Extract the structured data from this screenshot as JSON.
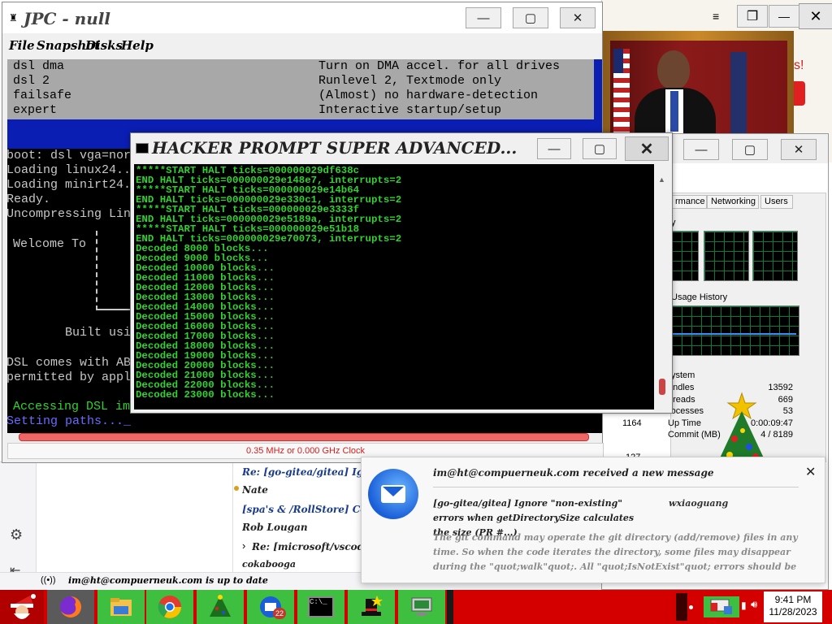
{
  "jpc": {
    "title": "JPC - null",
    "menu": [
      "File",
      "Snapshot",
      "Disks",
      "Help"
    ],
    "boot_menu": [
      {
        "key": "dsl dma",
        "desc": "Turn on DMA accel. for all drives"
      },
      {
        "key": "dsl 2",
        "desc": "Runlevel 2, Textmode only"
      },
      {
        "key": "failsafe",
        "desc": "(Almost) no hardware-detection"
      },
      {
        "key": "expert",
        "desc": "Interactive startup/setup"
      }
    ],
    "console_lines": [
      "boot: dsl vga=nor",
      "Loading linux24..",
      "Loading minirt24.",
      "Ready.",
      "Uncompressing Lin"
    ],
    "welcome": "Welcome To",
    "built": "Built usi",
    "dsl_line1": "DSL comes with AB",
    "dsl_line2": "permitted by appl",
    "accessing": "Accessing DSL im",
    "setting_paths": "Setting paths..._",
    "clock": "0.35 MHz or 0.000 GHz Clock"
  },
  "hacker": {
    "title": "HACKER PROMPT SUPER ADVANCED...",
    "lines": [
      "*****START HALT ticks=000000029df638c",
      "END HALT ticks=000000029e148e7, interrupts=2",
      "*****START HALT ticks=000000029e14b64",
      "END HALT ticks=000000029e330c1, interrupts=2",
      "*****START HALT ticks=000000029e3333f",
      "END HALT ticks=000000029e5189a, interrupts=2",
      "*****START HALT ticks=000000029e51b18",
      "END HALT ticks=000000029e70073, interrupts=2",
      "Decoded 8000 blocks...",
      "Decoded 9000 blocks...",
      "Decoded 10000 blocks...",
      "Decoded 11000 blocks...",
      "Decoded 12000 blocks...",
      "Decoded 13000 blocks...",
      "Decoded 14000 blocks...",
      "Decoded 15000 blocks...",
      "Decoded 16000 blocks...",
      "Decoded 17000 blocks...",
      "Decoded 18000 blocks...",
      "Decoded 19000 blocks...",
      "Decoded 20000 blocks...",
      "Decoded 21000 blocks...",
      "Decoded 22000 blocks...",
      "Decoded 23000 blocks..."
    ]
  },
  "taskmgr": {
    "tabs": [
      "rmance",
      "Networking",
      "Users"
    ],
    "usage_history": "Usage History",
    "system_label": "ystem",
    "system": [
      {
        "label": "andles",
        "value": "13592"
      },
      {
        "label": "hreads",
        "value": "669"
      },
      {
        "label": "rocesses",
        "value": "53"
      },
      {
        "label": "Up Time",
        "value": "0:00:09:47"
      },
      {
        "label": "Commit (MB)",
        "value": "4 / 8189"
      }
    ],
    "left_values": [
      "1164",
      "127"
    ]
  },
  "mail": {
    "items": [
      "Re: [go-gitea/gitea] Ignore",
      "Nate",
      "[spa's & /RollStore] Co",
      "Rob Lougan",
      "Re: [microsoft/vscode] S",
      "cokabooga"
    ],
    "status": "im@ht@compuerneuk.com is up to date",
    "notification": {
      "header": "im@ht@compuerneuk.com received a new message",
      "subject": "[go-gitea/gitea] Ignore \"non-existing\" errors when getDirectorySize calculates the size (PR #...)",
      "from": "wxiaoguang",
      "body": "The git command may operate the git directory (add/remove) files in any time. So when the code iterates the directory, some files may disappear during the \"quot;walk\"quot;. All \"quot;IsNotExist\"quot; errors should be ignored. Fix ... You can vie",
      "close": "✕"
    }
  },
  "taskbar": {
    "time": "9:41 PM",
    "date": "11/28/2023",
    "badge": "22"
  },
  "colors": {
    "term_green": "#2ed32e",
    "jpc_blue": "#0a1eb4",
    "taskbar_red": "#d40000"
  }
}
